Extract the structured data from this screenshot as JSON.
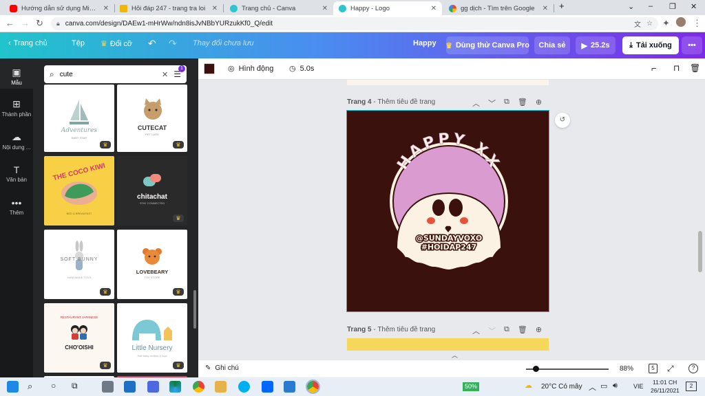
{
  "browser": {
    "tabs": [
      {
        "title": "Hướng dẫn sử dụng Microsoft Te",
        "icon": "youtube-icon",
        "color": "#ff0000"
      },
      {
        "title": "Hỏi đáp 247 - trang tra loi",
        "icon": "hoidap-icon",
        "color": "#f2b705"
      },
      {
        "title": "Trang chủ - Canva",
        "icon": "canva-icon",
        "color": "#2ec5ce"
      },
      {
        "title": "Happy - Logo",
        "icon": "canva-icon",
        "color": "#2ec5ce"
      },
      {
        "title": "gg dịch - Tìm trên Google",
        "icon": "google-icon",
        "color": "#4285f4"
      }
    ],
    "new_tab": "+",
    "window_controls": [
      "⌄",
      "–",
      "❐",
      "✕"
    ],
    "url": "canva.com/design/DAEw1-mHrWw/ndn8isJvNBbYURzukKf0_Q/edit"
  },
  "canva_header": {
    "home": "Trang chủ",
    "file": "Tệp",
    "resize": "Đổi cỡ",
    "save_status": "Thay đổi chưa lưu",
    "design_title": "Happy",
    "try_pro": "Dùng thử Canva Pro",
    "share": "Chia sẻ",
    "play_duration": "25.2s",
    "download": "Tải xuống",
    "more": "•••",
    "colors": {
      "pro": "#8b3dff",
      "accent": "#7d2ae8"
    }
  },
  "rail": [
    {
      "label": "Mẫu",
      "icon": "template-icon"
    },
    {
      "label": "Thành phần",
      "icon": "elements-icon"
    },
    {
      "label": "Nội dung ...",
      "icon": "upload-icon"
    },
    {
      "label": "Văn bản",
      "icon": "text-icon"
    },
    {
      "label": "Thêm",
      "icon": "more-icon"
    }
  ],
  "search": {
    "value": "cute",
    "filter_badge": "1"
  },
  "templates": [
    {
      "name": "Adventures",
      "sub": "BABY STAR",
      "bg": "#ffffff"
    },
    {
      "name": "CUTECAT",
      "sub": "PET CARE",
      "bg": "#ffffff"
    },
    {
      "name": "THE COCO KIWI",
      "sub": "BED & BREAKFAST",
      "bg": "#f7d046"
    },
    {
      "name": "chitachat",
      "sub": "STAY CONNECTED",
      "bg": "#2a2a2a"
    },
    {
      "name": "SOFT BUNNY",
      "sub": "HANDMADE TOYS",
      "bg": "#ffffff"
    },
    {
      "name": "LOVEBEARY",
      "sub": "TOY STORE",
      "bg": "#ffffff"
    },
    {
      "name": "CHO'OISHI",
      "sub": "RESTAURANT JAPANESE",
      "bg": "#ffffff"
    },
    {
      "name": "Little Nursery",
      "sub": "Soft baby clothes & toys",
      "bg": "#ffffff"
    }
  ],
  "toolbar": {
    "color_swatch": "#3b110d",
    "animate": "Hình động",
    "duration": "5.0s"
  },
  "pages": {
    "page4_label": "Trang 4",
    "page4_title": "Thêm tiêu đề trang",
    "page5_label": "Trang 5",
    "page5_title": "Thêm tiêu đề trang",
    "sep": "-"
  },
  "logo": {
    "arc_text": "HAPPY XX",
    "handle": "@SUNDAYVOXO",
    "tag": "#HOIDAP247",
    "colors": {
      "bg": "#3b110d",
      "circle": "#d99bd0",
      "ghost": "#fbf2e4"
    }
  },
  "bottombar": {
    "notes": "Ghi chú",
    "zoom": "88%",
    "page_count": "5",
    "help": "?"
  },
  "taskbar": {
    "battery": "50%",
    "weather": "20°C  Có mây",
    "lang": "VIE",
    "time": "11:01 CH",
    "date": "26/11/2021",
    "notif": "2"
  }
}
